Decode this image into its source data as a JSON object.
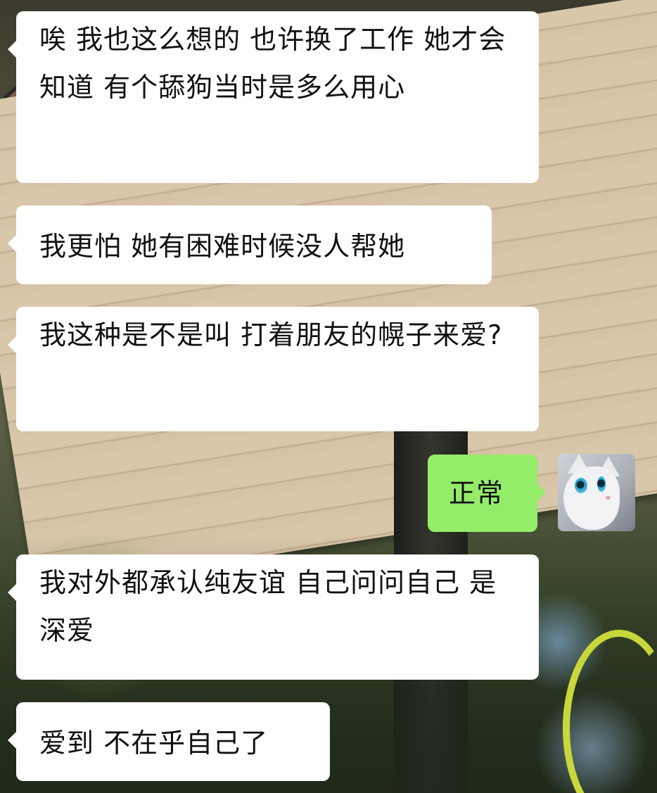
{
  "messages": [
    {
      "side": "in",
      "text": "唉 我也这么想的 也许换了工作 她才会知道 有个舔狗当时是多么用心"
    },
    {
      "side": "in",
      "text": "我更怕 她有困难时候没人帮她"
    },
    {
      "side": "in",
      "text": "我这种是不是叫 打着朋友的幌子来爱?"
    },
    {
      "side": "out",
      "text": "正常"
    },
    {
      "side": "in",
      "text": "我对外都承认纯友谊 自己问问自己 是深爱"
    },
    {
      "side": "in",
      "text": "爱到 不在乎自己了"
    }
  ],
  "colors": {
    "incoming_bubble": "#ffffff",
    "outgoing_bubble": "#95ec69",
    "text": "#111111"
  },
  "icons": {
    "avatar": "white-cat-avatar"
  }
}
